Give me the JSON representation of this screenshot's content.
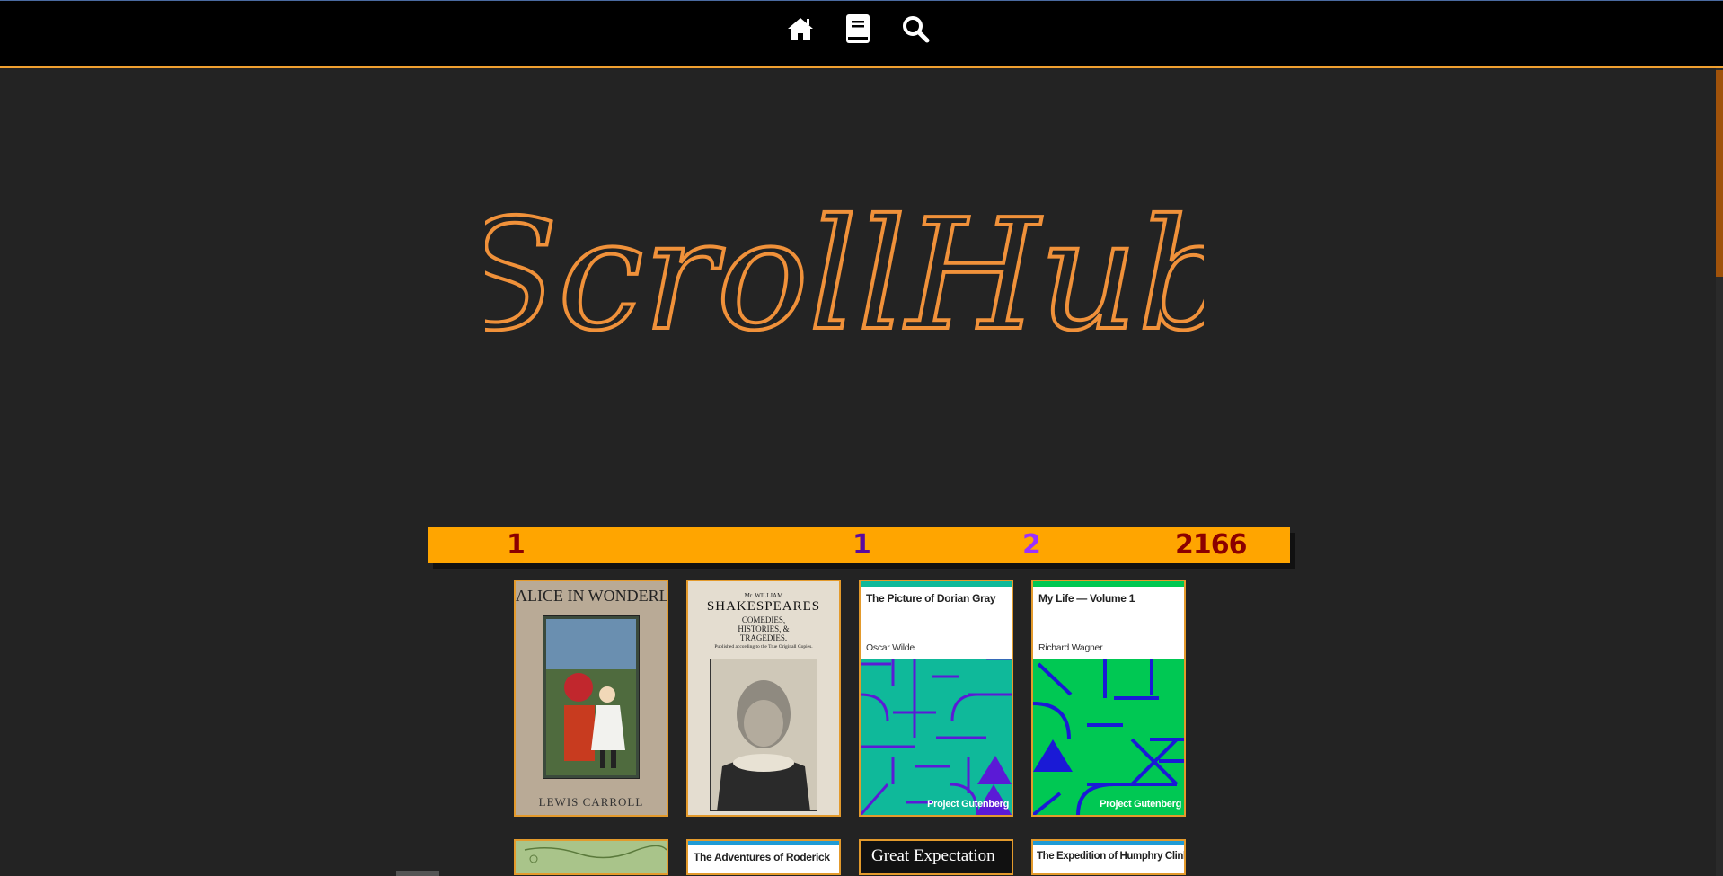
{
  "nav": {
    "icons": [
      "home-icon",
      "book-icon",
      "search-icon"
    ]
  },
  "logo": {
    "text": "ScrollHub",
    "color": "#f0913a"
  },
  "stats": {
    "values": [
      "1",
      "1",
      "2",
      "2166"
    ],
    "colors": [
      "#8b0000",
      "#5a0aa0",
      "#9b30ff",
      "#8b0000"
    ]
  },
  "books_row1": [
    {
      "cover_title": "ALICE IN WONDERLAND",
      "cover_author": "LEWIS CARROLL"
    },
    {
      "cover_line1": "Mr. WILLIAM",
      "cover_line2": "SHAKESPEARES",
      "cover_line3": "COMEDIES,",
      "cover_line4": "HISTORIES, &",
      "cover_line5": "TRAGEDIES.",
      "cover_line6": "Published according to the True Originall Copies."
    },
    {
      "title": "The Picture of Dorian Gray",
      "author": "Oscar Wilde",
      "label": "Project Gutenberg",
      "art_color": "#0fb99a",
      "line_color": "#5b1ad6"
    },
    {
      "title": "My Life — Volume 1",
      "author": "Richard Wagner",
      "label": "Project Gutenberg",
      "art_color": "#00c853",
      "line_color": "#1a1ad6"
    }
  ],
  "books_row2": [
    {
      "title": ""
    },
    {
      "title": "The Adventures of Roderick"
    },
    {
      "title": "Great Expectation"
    },
    {
      "title": "The Expedition of Humphry Clinker"
    }
  ]
}
